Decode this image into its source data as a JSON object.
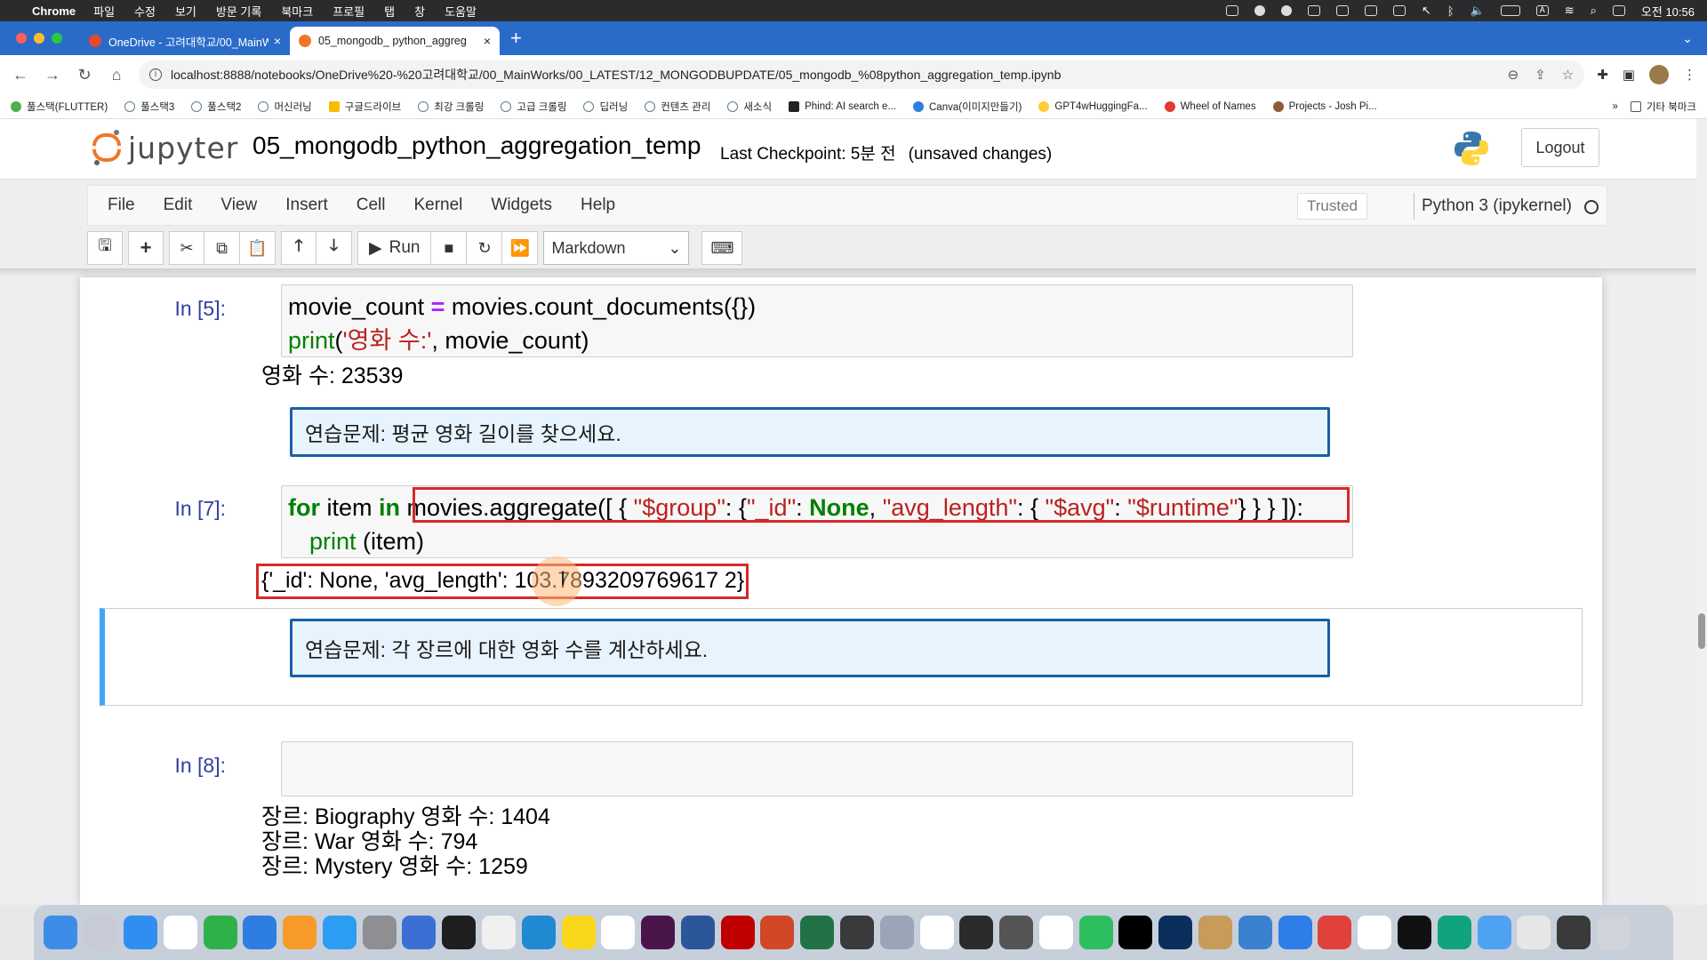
{
  "mac_menubar": {
    "app": "Chrome",
    "items": [
      "파일",
      "수정",
      "보기",
      "방문 기록",
      "북마크",
      "프로필",
      "탭",
      "창",
      "도움말"
    ],
    "clock": "오전 10:56"
  },
  "tabs": [
    {
      "title": "OneDrive - 고려대학교/00_MainW",
      "active": false,
      "color": "#e34b2c"
    },
    {
      "title": "05_mongodb_ python_aggreg",
      "active": true,
      "color": "#f37626"
    }
  ],
  "address": {
    "url": "localhost:8888/notebooks/OneDrive%20-%20고려대학교/00_MainWorks/00_LATEST/12_MONGODBUPDATE/05_mongodb_%08python_aggregation_temp.ipynb"
  },
  "bookmarks": [
    {
      "label": "풀스택(FLUTTER)",
      "color": "#4caf50"
    },
    {
      "label": "풀스택3",
      "color": "#607d8b"
    },
    {
      "label": "풀스택2",
      "color": "#607d8b"
    },
    {
      "label": "머신러닝",
      "color": "#607d8b"
    },
    {
      "label": "구글드라이브",
      "color": "#fbbc04"
    },
    {
      "label": "최강 크롤링",
      "color": "#607d8b"
    },
    {
      "label": "고급 크롤링",
      "color": "#607d8b"
    },
    {
      "label": "딥러닝",
      "color": "#607d8b"
    },
    {
      "label": "컨텐츠 관리",
      "color": "#607d8b"
    },
    {
      "label": "새소식",
      "color": "#607d8b"
    },
    {
      "label": "Phind: AI search e...",
      "color": "#222222"
    },
    {
      "label": "Canva(이미지만들기)",
      "color": "#2e7de0"
    },
    {
      "label": "GPT4wHuggingFa...",
      "color": "#ffcc33"
    },
    {
      "label": "Wheel of Names",
      "color": "#e53935"
    },
    {
      "label": "Projects - Josh Pi...",
      "color": "#8d5a3b"
    }
  ],
  "bookmarks_more": "»",
  "bookmarks_other": "기타 북마크",
  "jupyter": {
    "logo_text": "jupyter",
    "notebook_title": "05_mongodb_python_aggregation_temp",
    "checkpoint": "Last Checkpoint: 5분 전",
    "unsaved": "(unsaved changes)",
    "logout": "Logout",
    "menu": [
      "File",
      "Edit",
      "View",
      "Insert",
      "Cell",
      "Kernel",
      "Widgets",
      "Help"
    ],
    "trusted": "Trusted",
    "kernel": "Python 3 (ipykernel)",
    "run_label": "Run",
    "cell_type": "Markdown"
  },
  "cells": {
    "c5": {
      "prompt": "In [5]:",
      "line1": {
        "a": "movie_count ",
        "op": "=",
        "b": " movies.count_documents({})"
      },
      "line2": {
        "fn": "print",
        "open": "(",
        "s": "'영화 수:'",
        "rest": ", movie_count)"
      },
      "output": "영화 수: 23539"
    },
    "md1": "연습문제: 평균 영화 길이를 찾으세요.",
    "c7": {
      "prompt": "In [7]:",
      "kw_for": "for",
      "item": " item ",
      "kw_in": "in",
      "agg_open": " movies.aggregate([ { ",
      "s_group": "\"$group\"",
      "p1": ": {",
      "s_id": "\"_id\"",
      "p2": ": ",
      "kw_none": "None",
      "p3": ", ",
      "s_avg_length": "\"avg_length\"",
      "p4": ": { ",
      "s_avg": "\"$avg\"",
      "p5": ": ",
      "s_runtime": "\"$runtime\"",
      "agg_close": "} } } ]):",
      "line2_fn": "print",
      "line2_rest": " (item)",
      "output": "{'_id': None, 'avg_length': 103.7893209769617 2}"
    },
    "md2": "연습문제: 각 장르에 대한 영화 수를 계산하세요.",
    "c8": {
      "prompt": "In [8]:",
      "out1": "장르: Biography 영화 수: 1404",
      "out2": "장르: War 영화 수: 794",
      "out3": "장르: Mystery 영화 수: 1259"
    }
  },
  "dock_icons": [
    "finder",
    "launchpad",
    "safari",
    "calendar",
    "numbers",
    "keynote",
    "pages",
    "appstore",
    "settings",
    "files",
    "terminal",
    "textedit",
    "vscode",
    "kakaotalk",
    "chrome",
    "slack",
    "word",
    "filezilla",
    "powerpoint",
    "excel",
    "calculator",
    "preview",
    "vectorize",
    "finalcut",
    "raycast",
    "typora",
    "evernote",
    "intellij",
    "webstorm",
    "archive",
    "monitor",
    "xcode",
    "anydesk",
    "chrome2",
    "github",
    "chatgpt",
    "folder",
    "documents",
    "screen",
    "trash"
  ],
  "colors": {
    "chrome_blue": "#2a6bc9",
    "jupyter_orange": "#f37626",
    "prompt_blue": "#303f9f",
    "highlight_red": "#d42a2a",
    "md_border": "#1b5fa8"
  }
}
